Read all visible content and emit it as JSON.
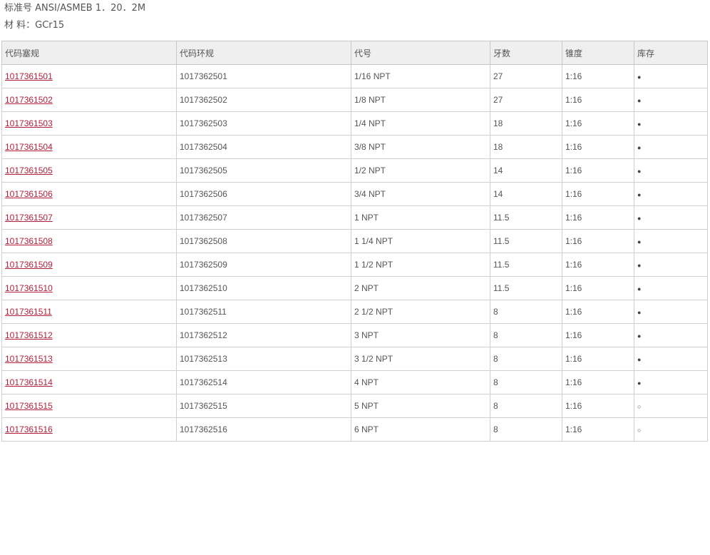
{
  "header": {
    "standard": "标准号 ANSI/ASMEB 1．20．2M",
    "material": "材 料：GCr15"
  },
  "table": {
    "columns": [
      "代码塞规",
      "代码环规",
      "代号",
      "牙数",
      "锥度",
      "库存"
    ],
    "rows": [
      {
        "plug": "1017361501",
        "ring": "1017362501",
        "code": "1/16 NPT",
        "threads": "27",
        "taper": "1:16",
        "stock": "●"
      },
      {
        "plug": "1017361502",
        "ring": "1017362502",
        "code": "1/8 NPT",
        "threads": "27",
        "taper": "1:16",
        "stock": "●"
      },
      {
        "plug": "1017361503",
        "ring": "1017362503",
        "code": "1/4 NPT",
        "threads": "18",
        "taper": "1:16",
        "stock": "●"
      },
      {
        "plug": "1017361504",
        "ring": "1017362504",
        "code": "3/8 NPT",
        "threads": "18",
        "taper": "1:16",
        "stock": "●"
      },
      {
        "plug": "1017361505",
        "ring": "1017362505",
        "code": "1/2 NPT",
        "threads": "14",
        "taper": "1:16",
        "stock": "●"
      },
      {
        "plug": "1017361506",
        "ring": "1017362506",
        "code": "3/4 NPT",
        "threads": "14",
        "taper": "1:16",
        "stock": "●"
      },
      {
        "plug": "1017361507",
        "ring": "1017362507",
        "code": "1 NPT",
        "threads": "11.5",
        "taper": "1:16",
        "stock": "●"
      },
      {
        "plug": "1017361508",
        "ring": "1017362508",
        "code": "1 1/4 NPT",
        "threads": "11.5",
        "taper": "1:16",
        "stock": "●"
      },
      {
        "plug": "1017361509",
        "ring": "1017362509",
        "code": "1 1/2 NPT",
        "threads": "11.5",
        "taper": "1:16",
        "stock": "●"
      },
      {
        "plug": "1017361510",
        "ring": "1017362510",
        "code": "2 NPT",
        "threads": "11.5",
        "taper": "1:16",
        "stock": "●"
      },
      {
        "plug": "1017361511",
        "ring": "1017362511",
        "code": "2 1/2 NPT",
        "threads": "8",
        "taper": "1:16",
        "stock": "●"
      },
      {
        "plug": "1017361512",
        "ring": "1017362512",
        "code": "3 NPT",
        "threads": "8",
        "taper": "1:16",
        "stock": "●"
      },
      {
        "plug": "1017361513",
        "ring": "1017362513",
        "code": "3 1/2 NPT",
        "threads": "8",
        "taper": "1:16",
        "stock": "●"
      },
      {
        "plug": "1017361514",
        "ring": "1017362514",
        "code": "4 NPT",
        "threads": "8",
        "taper": "1:16",
        "stock": "●"
      },
      {
        "plug": "1017361515",
        "ring": "1017362515",
        "code": "5 NPT",
        "threads": "8",
        "taper": "1:16",
        "stock": "○"
      },
      {
        "plug": "1017361516",
        "ring": "1017362516",
        "code": "6 NPT",
        "threads": "8",
        "taper": "1:16",
        "stock": "○"
      }
    ]
  },
  "colors": {
    "link": "#b2203a",
    "text": "#555555",
    "header_bg": "#efefef",
    "border": "#cfcfcf"
  }
}
